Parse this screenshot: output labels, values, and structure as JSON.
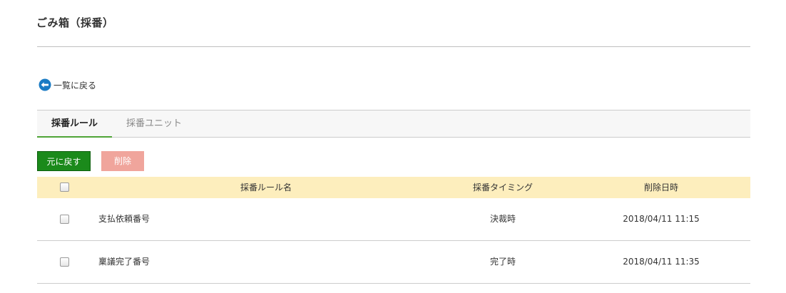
{
  "page": {
    "title": "ごみ箱（採番）"
  },
  "back_link": {
    "label": "一覧に戻る",
    "icon": "arrow-left-circle-icon"
  },
  "tabs": [
    {
      "label": "採番ルール",
      "active": true
    },
    {
      "label": "採番ユニット",
      "active": false
    }
  ],
  "toolbar": {
    "restore_label": "元に戻す",
    "delete_label": "削除"
  },
  "table": {
    "columns": [
      "採番ルール名",
      "採番タイミング",
      "削除日時"
    ],
    "rows": [
      {
        "name": "支払依頼番号",
        "timing": "決裁時",
        "deleted_at": "2018/04/11 11:15"
      },
      {
        "name": "稟議完了番号",
        "timing": "完了時",
        "deleted_at": "2018/04/11 11:35"
      }
    ]
  },
  "colors": {
    "accent_green": "#1b8a1b",
    "tab_underline": "#4fa436",
    "delete_button": "#f0a59c",
    "table_header": "#fdeebd",
    "back_icon": "#1a7bc4"
  }
}
